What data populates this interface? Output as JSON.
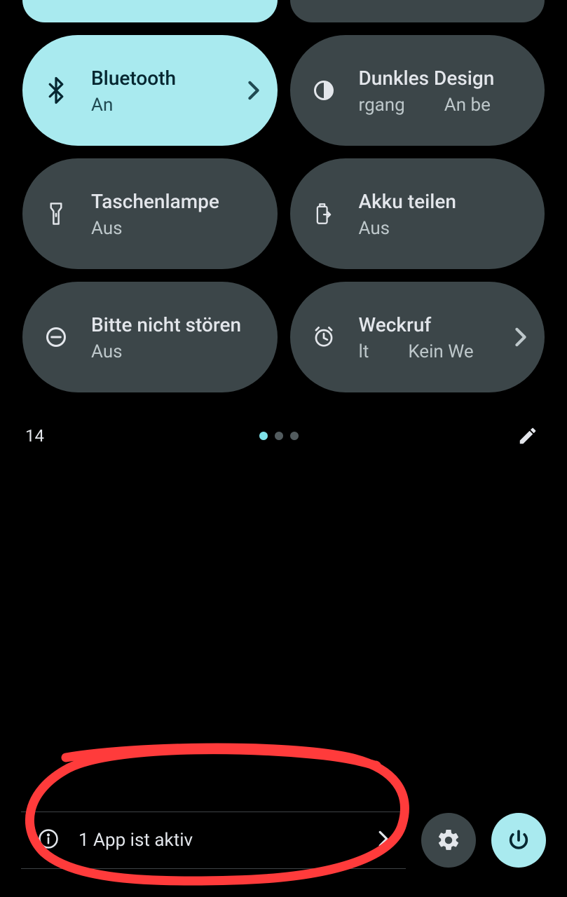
{
  "tiles": {
    "row0": [
      {
        "title": "",
        "sub": "",
        "state": "on",
        "icon": "generic",
        "chevron": false,
        "short": true
      },
      {
        "title": "",
        "sub": "",
        "state": "off",
        "icon": "generic",
        "chevron": false,
        "short": true
      }
    ],
    "row1": [
      {
        "title": "Bluetooth",
        "sub": "An",
        "state": "on",
        "icon": "bluetooth",
        "chevron": true
      },
      {
        "title": "Dunkles Design",
        "sub_a": "rgang",
        "sub_b": "An be",
        "state": "off",
        "icon": "contrast",
        "chevron": false,
        "marquee": true
      }
    ],
    "row2": [
      {
        "title": "Taschenlampe",
        "sub": "Aus",
        "state": "off",
        "icon": "flashlight",
        "chevron": false
      },
      {
        "title": "Akku teilen",
        "sub": "Aus",
        "state": "off",
        "icon": "battery-share",
        "chevron": false
      }
    ],
    "row3": [
      {
        "title": "Bitte nicht stören",
        "sub": "Aus",
        "state": "off",
        "icon": "dnd",
        "chevron": false
      },
      {
        "title": "Weckruf",
        "sub_a": "lt",
        "sub_b": "Kein We",
        "state": "off",
        "icon": "alarm",
        "chevron": true,
        "marquee": true
      }
    ]
  },
  "pager": {
    "battery": "14",
    "pages": 3,
    "active": 0
  },
  "bottom": {
    "active_apps": "1 App ist aktiv"
  },
  "colors": {
    "accent": "#a9eaef",
    "tile_off": "#3c4649"
  },
  "annotation": {
    "shape": "freehand-circle",
    "color": "#ff3b3b"
  }
}
